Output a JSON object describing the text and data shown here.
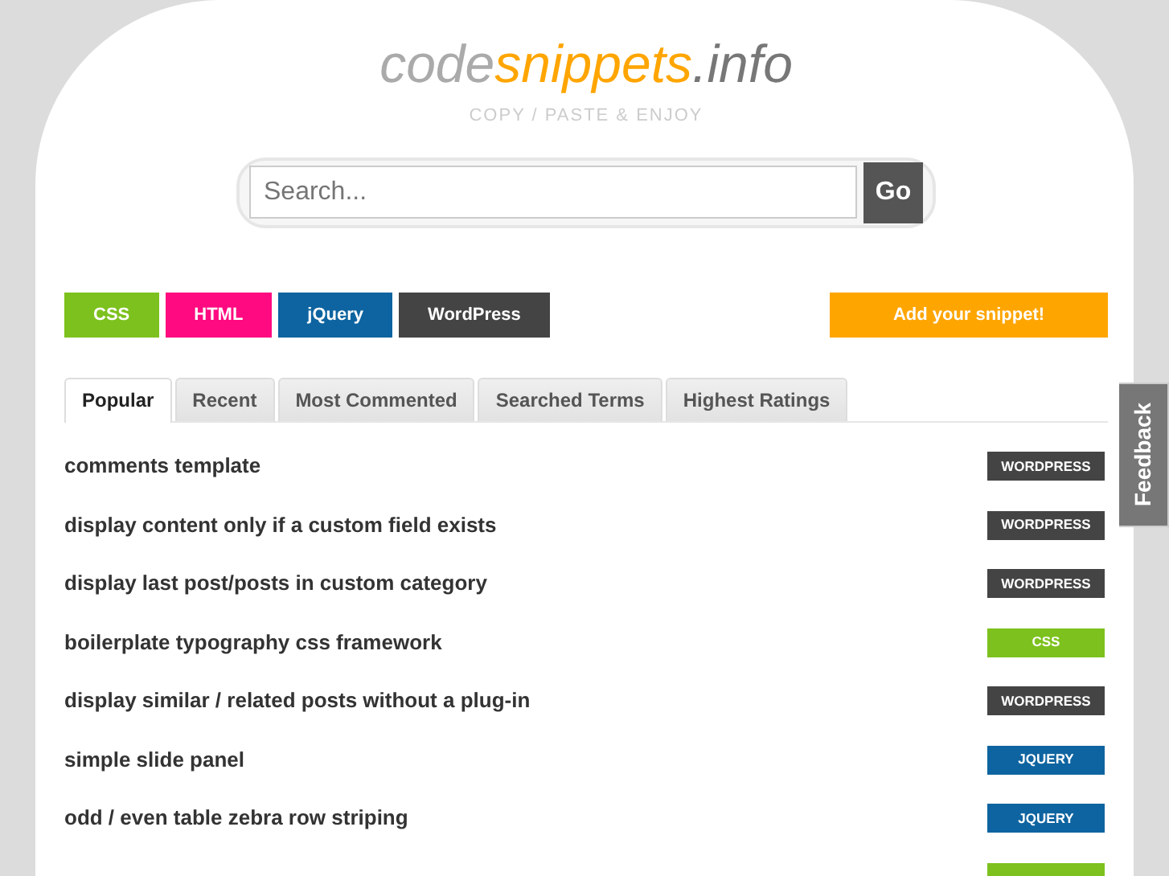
{
  "logo": {
    "part_1": "code",
    "part_2": "snippets",
    "part_3": ".info"
  },
  "tagline": "COPY / PASTE & ENJOY",
  "search": {
    "placeholder": "Search...",
    "button": "Go"
  },
  "categories": [
    {
      "label": "CSS",
      "kind": "css"
    },
    {
      "label": "HTML",
      "kind": "html"
    },
    {
      "label": "jQuery",
      "kind": "jquery"
    },
    {
      "label": "WordPress",
      "kind": "wordpress"
    }
  ],
  "add_button": "Add your snippet!",
  "tabs": [
    {
      "label": "Popular",
      "selected": true
    },
    {
      "label": "Recent",
      "selected": false
    },
    {
      "label": "Most Commented",
      "selected": false
    },
    {
      "label": "Searched Terms",
      "selected": false
    },
    {
      "label": "Highest Ratings",
      "selected": false
    }
  ],
  "snippets": [
    {
      "title": "comments template",
      "tag": "WORDPRESS",
      "kind": "wordpress"
    },
    {
      "title": "display content only if a custom field exists",
      "tag": "WORDPRESS",
      "kind": "wordpress"
    },
    {
      "title": "display last post/posts in custom category",
      "tag": "WORDPRESS",
      "kind": "wordpress"
    },
    {
      "title": "boilerplate typography css framework",
      "tag": "CSS",
      "kind": "css"
    },
    {
      "title": "display similar / related posts without a plug-in",
      "tag": "WORDPRESS",
      "kind": "wordpress"
    },
    {
      "title": "simple slide panel",
      "tag": "JQUERY",
      "kind": "jquery"
    },
    {
      "title": "odd / even table zebra row striping",
      "tag": "JQUERY",
      "kind": "jquery"
    },
    {
      "kind": "css"
    }
  ],
  "feedback": "Feedback"
}
